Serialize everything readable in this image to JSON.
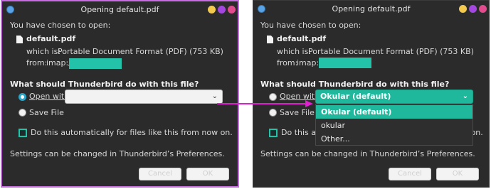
{
  "dialog": {
    "title": "Opening default.pdf",
    "chosen_label": "You have chosen to open:",
    "file_name": "default.pdf",
    "which_is_label": "which is:",
    "which_is_value": "Portable Document Format (PDF) (753 KB)",
    "from_label": "from:",
    "from_value": "imap://",
    "question": "What should Thunderbird do with this file?",
    "open_with_label": "Open with",
    "save_file_label": "Save File",
    "auto_label": "Do this automatically for files like this from now on.",
    "settings_note": "Settings can be changed in Thunderbird’s Preferences.",
    "cancel_label": "Cancel",
    "ok_label": "OK"
  },
  "left": {
    "open_with_value": ""
  },
  "right": {
    "open_with_value": "Okular (default)",
    "dropdown_options": [
      "Okular (default)",
      "okular",
      "Other..."
    ]
  },
  "colors": {
    "accent_teal": "#22c3a8",
    "annotation_arrow": "#e020d0",
    "highlight_border": "#c66be0"
  },
  "icons": {
    "app": "thunderbird-icon",
    "file": "file-icon",
    "dropdown": "chevron-down-icon"
  }
}
